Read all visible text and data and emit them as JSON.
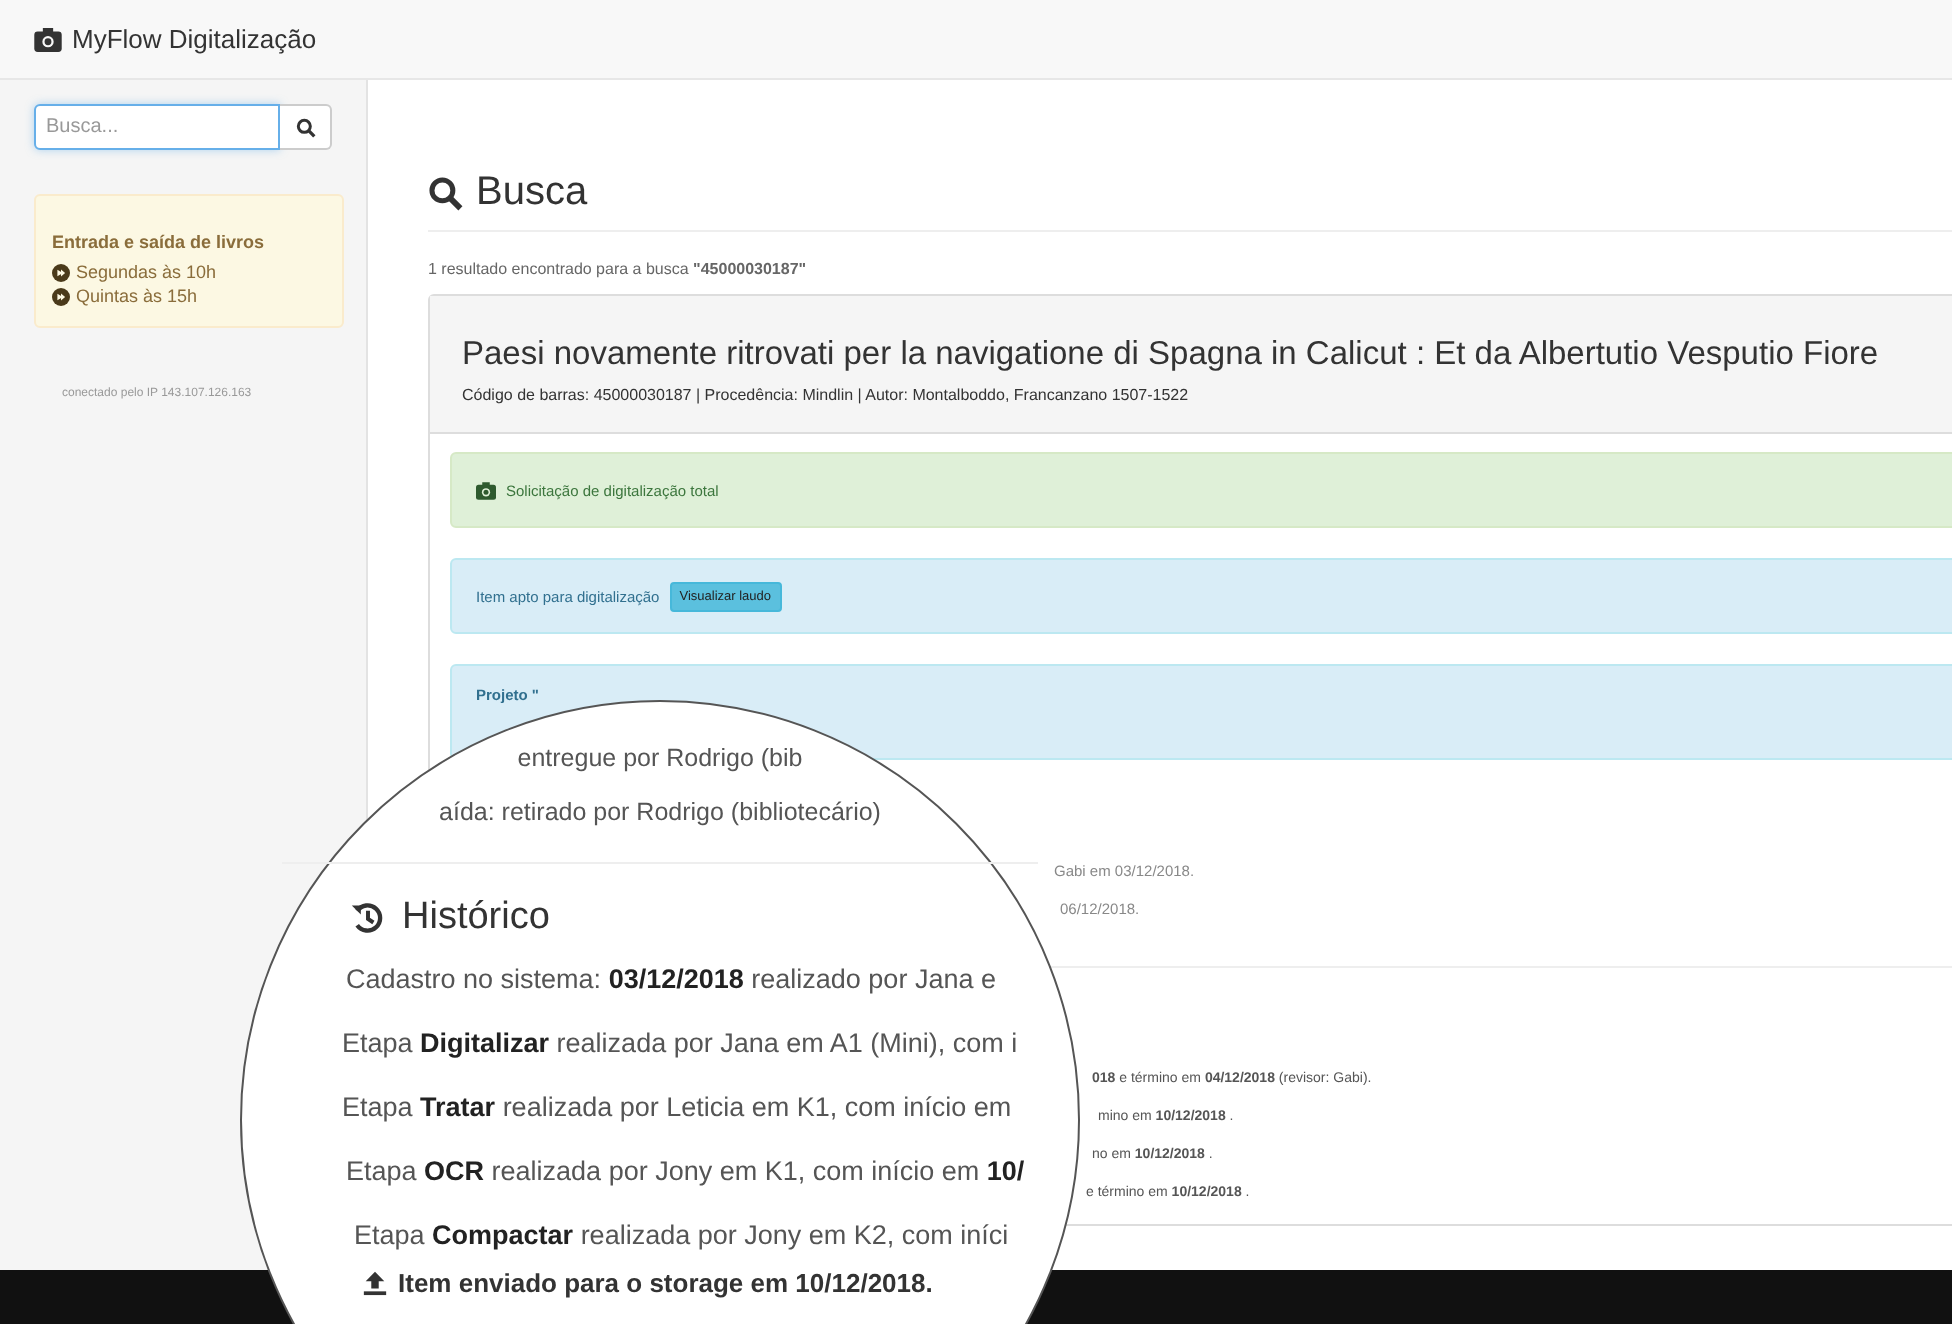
{
  "brand": "MyFlow Digitalização",
  "sidebar": {
    "search": {
      "placeholder": "Busca..."
    },
    "schedule": {
      "title": "Entrada e saída de livros",
      "items": [
        "Segundas às 10h",
        "Quintas às 15h"
      ]
    },
    "ip_note": "conectado pelo IP 143.107.126.163"
  },
  "main": {
    "heading": "Busca",
    "result_note": "1 resultado encontrado para a busca **\"45000030187\"**",
    "record": {
      "title": "Paesi novamente ritrovati per la navigatione di Spagna in Calicut : Et da Albertutio Vesputio Fiore",
      "meta": "Código de barras: 45000030187 | Procedência: Mindlin | Autor: Montalboddo, Francanzano 1507-1522",
      "alerts": [
        {
          "kind": "success",
          "text": "Solicitação de digitalização total"
        },
        {
          "kind": "info",
          "text": "Item apto para digitalização",
          "button": "Visualizar laudo"
        },
        {
          "kind": "project",
          "text": "Projeto \""
        }
      ],
      "movement_fragments": [
        "Gabi em 03/12/2018.",
        "06/12/2018."
      ],
      "history_fragments": [
        "**018** e término em **04/12/2018** (revisor: Gabi).",
        "mino em **10/12/2018** .",
        "no em **10/12/2018** .",
        "e término em **10/12/2018** ."
      ]
    }
  },
  "magnifier": {
    "movement_lines": [
      "entregue por Rodrigo (bib",
      "aída: retirado por Rodrigo (bibliotecário)"
    ],
    "history_title": "Histórico",
    "history_lines": [
      "Cadastro no sistema: **03/12/2018** realizado por Jana e",
      "Etapa **Digitalizar** realizada por Jana em A1 (Mini), com i",
      "Etapa **Tratar** realizada por Leticia em K1, com início em",
      "Etapa **OCR** realizada por Jony em K1, com início em **10/**",
      "Etapa **Compactar** realizada por Jony em K2, com iníci"
    ],
    "upload_line": "Item enviado para o storage em 10/12/2018."
  }
}
